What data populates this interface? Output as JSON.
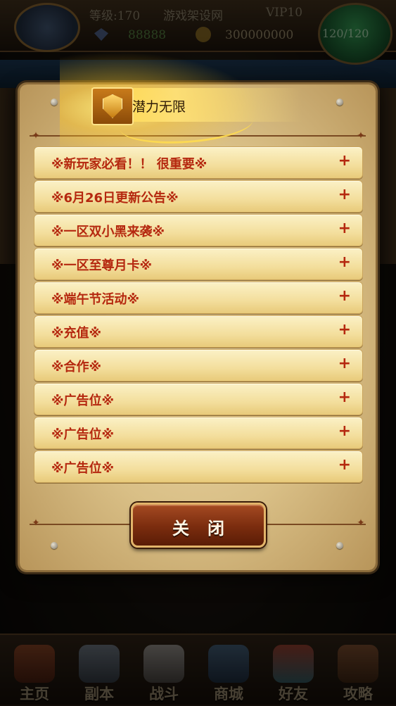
{
  "status_bar": {
    "level": "等级:170",
    "site": "游戏架设网",
    "vip": "VIP10",
    "gems": "88888",
    "gold": "300000000",
    "energy": "120/120"
  },
  "dialog": {
    "title": "潜力无限",
    "items": [
      {
        "label": "※新玩家必看！！ 很重要※",
        "icon": "+"
      },
      {
        "label": "※6月26日更新公告※",
        "icon": "+"
      },
      {
        "label": "※一区双小黑来袭※",
        "icon": "+"
      },
      {
        "label": "※一区至尊月卡※",
        "icon": "+"
      },
      {
        "label": "※端午节活动※",
        "icon": "+"
      },
      {
        "label": "※充值※",
        "icon": "+"
      },
      {
        "label": "※合作※",
        "icon": "+"
      },
      {
        "label": "※广告位※",
        "icon": "+"
      },
      {
        "label": "※广告位※",
        "icon": "+"
      },
      {
        "label": "※广告位※",
        "icon": "+"
      }
    ],
    "close_label": "关闭"
  },
  "bottom_nav": [
    {
      "label": "主页",
      "icon": "chest-icon"
    },
    {
      "label": "副本",
      "icon": "helmet-icon"
    },
    {
      "label": "战斗",
      "icon": "sword-icon"
    },
    {
      "label": "商城",
      "icon": "shop-icon"
    },
    {
      "label": "好友",
      "icon": "friends-icon"
    },
    {
      "label": "攻略",
      "icon": "scroll-icon"
    }
  ],
  "colors": {
    "item_text": "#b5280f",
    "parchment": "#e3c98e",
    "title_glow": "#ffd84a"
  }
}
